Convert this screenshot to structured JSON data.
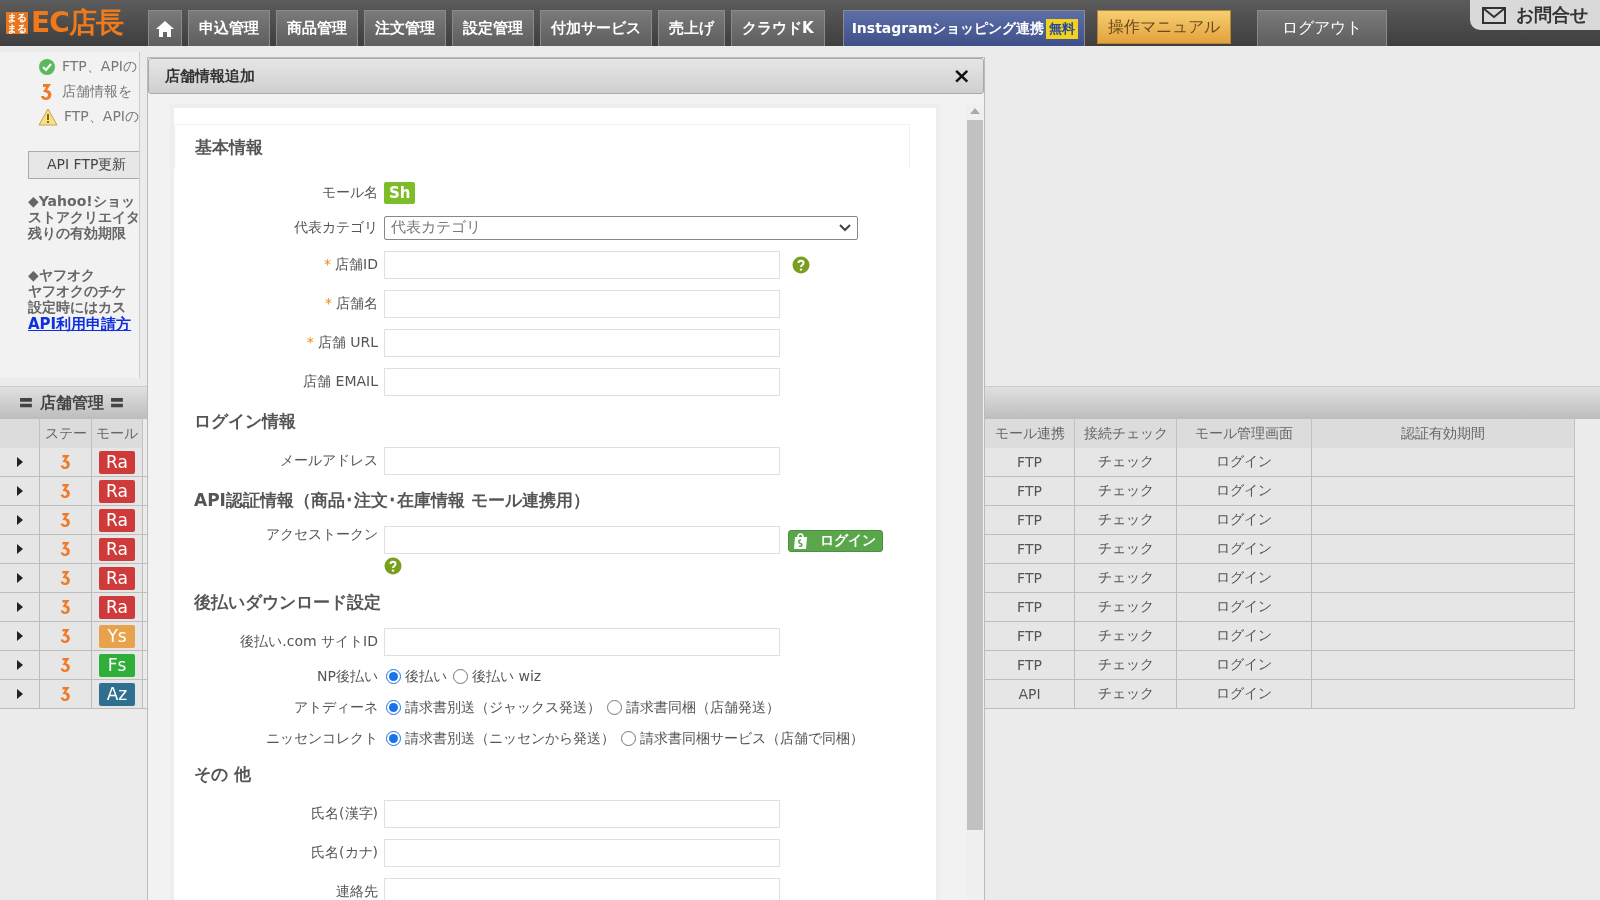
{
  "header": {
    "logo_mark": "まるまる",
    "logo": "EC店長",
    "nav": [
      {
        "label": "申込管理"
      },
      {
        "label": "商品管理"
      },
      {
        "label": "注文管理"
      },
      {
        "label": "設定管理"
      },
      {
        "label": "付加サービス"
      },
      {
        "label": "売上げ"
      },
      {
        "label": "クラウドK"
      }
    ],
    "instagram": {
      "label": "Instagramショッピング連携",
      "badge": "無料"
    },
    "manual": "操作マニュアル",
    "logout": "ログアウト",
    "contact": "お問合せ"
  },
  "info_panel": {
    "legend": [
      {
        "kind": "ok",
        "text": "FTP、APIの"
      },
      {
        "kind": "pending",
        "text": "店舗情報を"
      },
      {
        "kind": "warning",
        "text": "FTP、APIの"
      }
    ],
    "update_button": "API FTP更新",
    "notes": [
      {
        "lines": [
          "◆Yahoo!ショッ",
          "ストアクリエイタ",
          "残りの有効期限"
        ]
      },
      {
        "lines": [
          "◆ヤフオク",
          "ヤフオクのチケ",
          "設定時にはカス"
        ],
        "link": "API利用申請方"
      }
    ]
  },
  "store_table": {
    "title": "〓 店舗管理 〓",
    "columns_left": [
      "ステー",
      "モール"
    ],
    "columns_right": [
      "モール連携",
      "接続チェック",
      "モール管理画面",
      "認証有効期間"
    ],
    "rows": [
      {
        "mall": "Ra",
        "color": "#cf3b3b",
        "link": "FTP",
        "check": "チェック",
        "login": "ログイン"
      },
      {
        "mall": "Ra",
        "color": "#cf3b3b",
        "link": "FTP",
        "check": "チェック",
        "login": "ログイン"
      },
      {
        "mall": "Ra",
        "color": "#cf3b3b",
        "link": "FTP",
        "check": "チェック",
        "login": "ログイン"
      },
      {
        "mall": "Ra",
        "color": "#cf3b3b",
        "link": "FTP",
        "check": "チェック",
        "login": "ログイン"
      },
      {
        "mall": "Ra",
        "color": "#cf3b3b",
        "link": "FTP",
        "check": "チェック",
        "login": "ログイン"
      },
      {
        "mall": "Ra",
        "color": "#cf3b3b",
        "link": "FTP",
        "check": "チェック",
        "login": "ログイン"
      },
      {
        "mall": "Ys",
        "color": "#e9a24c",
        "link": "FTP",
        "check": "チェック",
        "login": "ログイン"
      },
      {
        "mall": "Fs",
        "color": "#2fae3a",
        "link": "FTP",
        "check": "チェック",
        "login": "ログイン"
      },
      {
        "mall": "Az",
        "color": "#2f6f8f",
        "link": "API",
        "check": "チェック",
        "login": "ログイン"
      }
    ]
  },
  "dialog": {
    "title": "店舗情報追加",
    "close": "×",
    "sections": [
      {
        "title": "基本情報",
        "boxed": true,
        "fields": [
          {
            "kind": "mall",
            "label": "モール名",
            "badge": "Sh"
          },
          {
            "kind": "select",
            "label": "代表カテゴリ",
            "value": "代表カテゴリ"
          },
          {
            "kind": "text",
            "label": "店舗ID",
            "required_mark": "*",
            "help": true
          },
          {
            "kind": "text",
            "label": "店舗名",
            "required_mark": "*"
          },
          {
            "kind": "text",
            "label": "店舗 URL",
            "required_mark": "*"
          },
          {
            "kind": "text",
            "label": "店舗 EMAIL"
          }
        ]
      },
      {
        "title": "ログイン情報",
        "fields": [
          {
            "kind": "text",
            "label": "メールアドレス"
          }
        ]
      },
      {
        "title": "API認証情報（商品･注文･在庫情報 モール連携用）",
        "fields": [
          {
            "kind": "token",
            "label": "アクセストークン",
            "button": "ログイン",
            "help": true
          }
        ]
      },
      {
        "title": "後払いダウンロード設定",
        "fields": [
          {
            "kind": "text",
            "label": "後払い.com サイトID"
          },
          {
            "kind": "radio",
            "label": "NP後払い",
            "options": [
              {
                "label": "後払い",
                "selected": true
              },
              {
                "label": "後払い wiz",
                "selected": false
              }
            ]
          },
          {
            "kind": "radio",
            "label": "アトディーネ",
            "options": [
              {
                "label": "請求書別送（ジャックス発送）",
                "selected": true
              },
              {
                "label": "請求書同梱（店舗発送）",
                "selected": false
              }
            ]
          },
          {
            "kind": "radio",
            "label": "ニッセンコレクト",
            "options": [
              {
                "label": "請求書別送（ニッセンから発送）",
                "selected": true
              },
              {
                "label": "請求書同梱サービス（店舗で同梱）",
                "selected": false
              }
            ]
          }
        ]
      },
      {
        "title": "その 他",
        "fields": [
          {
            "kind": "text",
            "label": "氏名(漢字)"
          },
          {
            "kind": "text",
            "label": "氏名(カナ)"
          },
          {
            "kind": "text",
            "label": "連絡先"
          }
        ]
      }
    ]
  }
}
